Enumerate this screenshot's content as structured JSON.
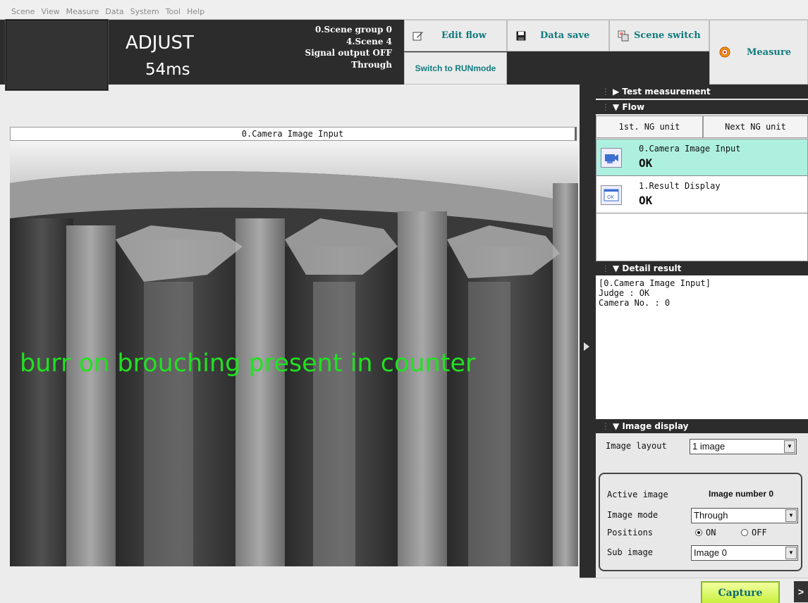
{
  "menu": [
    "Scene",
    "View",
    "Measure",
    "Data",
    "System",
    "Tool",
    "Help"
  ],
  "status": {
    "mode": "ADJUST",
    "time": "54ms",
    "scene_group": "0.Scene group 0",
    "scene": "4.Scene 4",
    "signal_output": "Signal output OFF",
    "image_mode": "Through"
  },
  "toolbar": {
    "edit_flow": "Edit flow",
    "data_save": "Data save",
    "scene_switch": "Scene switch",
    "switch_run": "Switch to RUNmode",
    "measure": "Measure"
  },
  "viewer": {
    "title": "0.Camera Image Input",
    "overlay_text": "burr on brouching present in counter"
  },
  "panel": {
    "test_measurement": "Test measurement",
    "flow": {
      "header": "Flow",
      "first_ng": "1st. NG unit",
      "next_ng": "Next NG unit",
      "items": [
        {
          "name": "0.Camera Image Input",
          "result": "OK"
        },
        {
          "name": "1.Result Display",
          "result": "OK"
        }
      ]
    },
    "detail": {
      "header": "Detail result",
      "lines": [
        "[0.Camera Image Input]",
        "",
        "Judge : OK",
        "Camera No. : 0"
      ]
    },
    "image_display": {
      "header": "Image display",
      "layout_label": "Image layout",
      "layout_value": "1 image",
      "active_label": "Active image",
      "active_value": "Image number 0",
      "mode_label": "Image mode",
      "mode_value": "Through",
      "positions_label": "Positions",
      "pos_on": "ON",
      "pos_off": "OFF",
      "sub_label": "Sub image",
      "sub_value": "Image 0"
    }
  },
  "bottom": {
    "capture": "Capture",
    "more": ">"
  }
}
